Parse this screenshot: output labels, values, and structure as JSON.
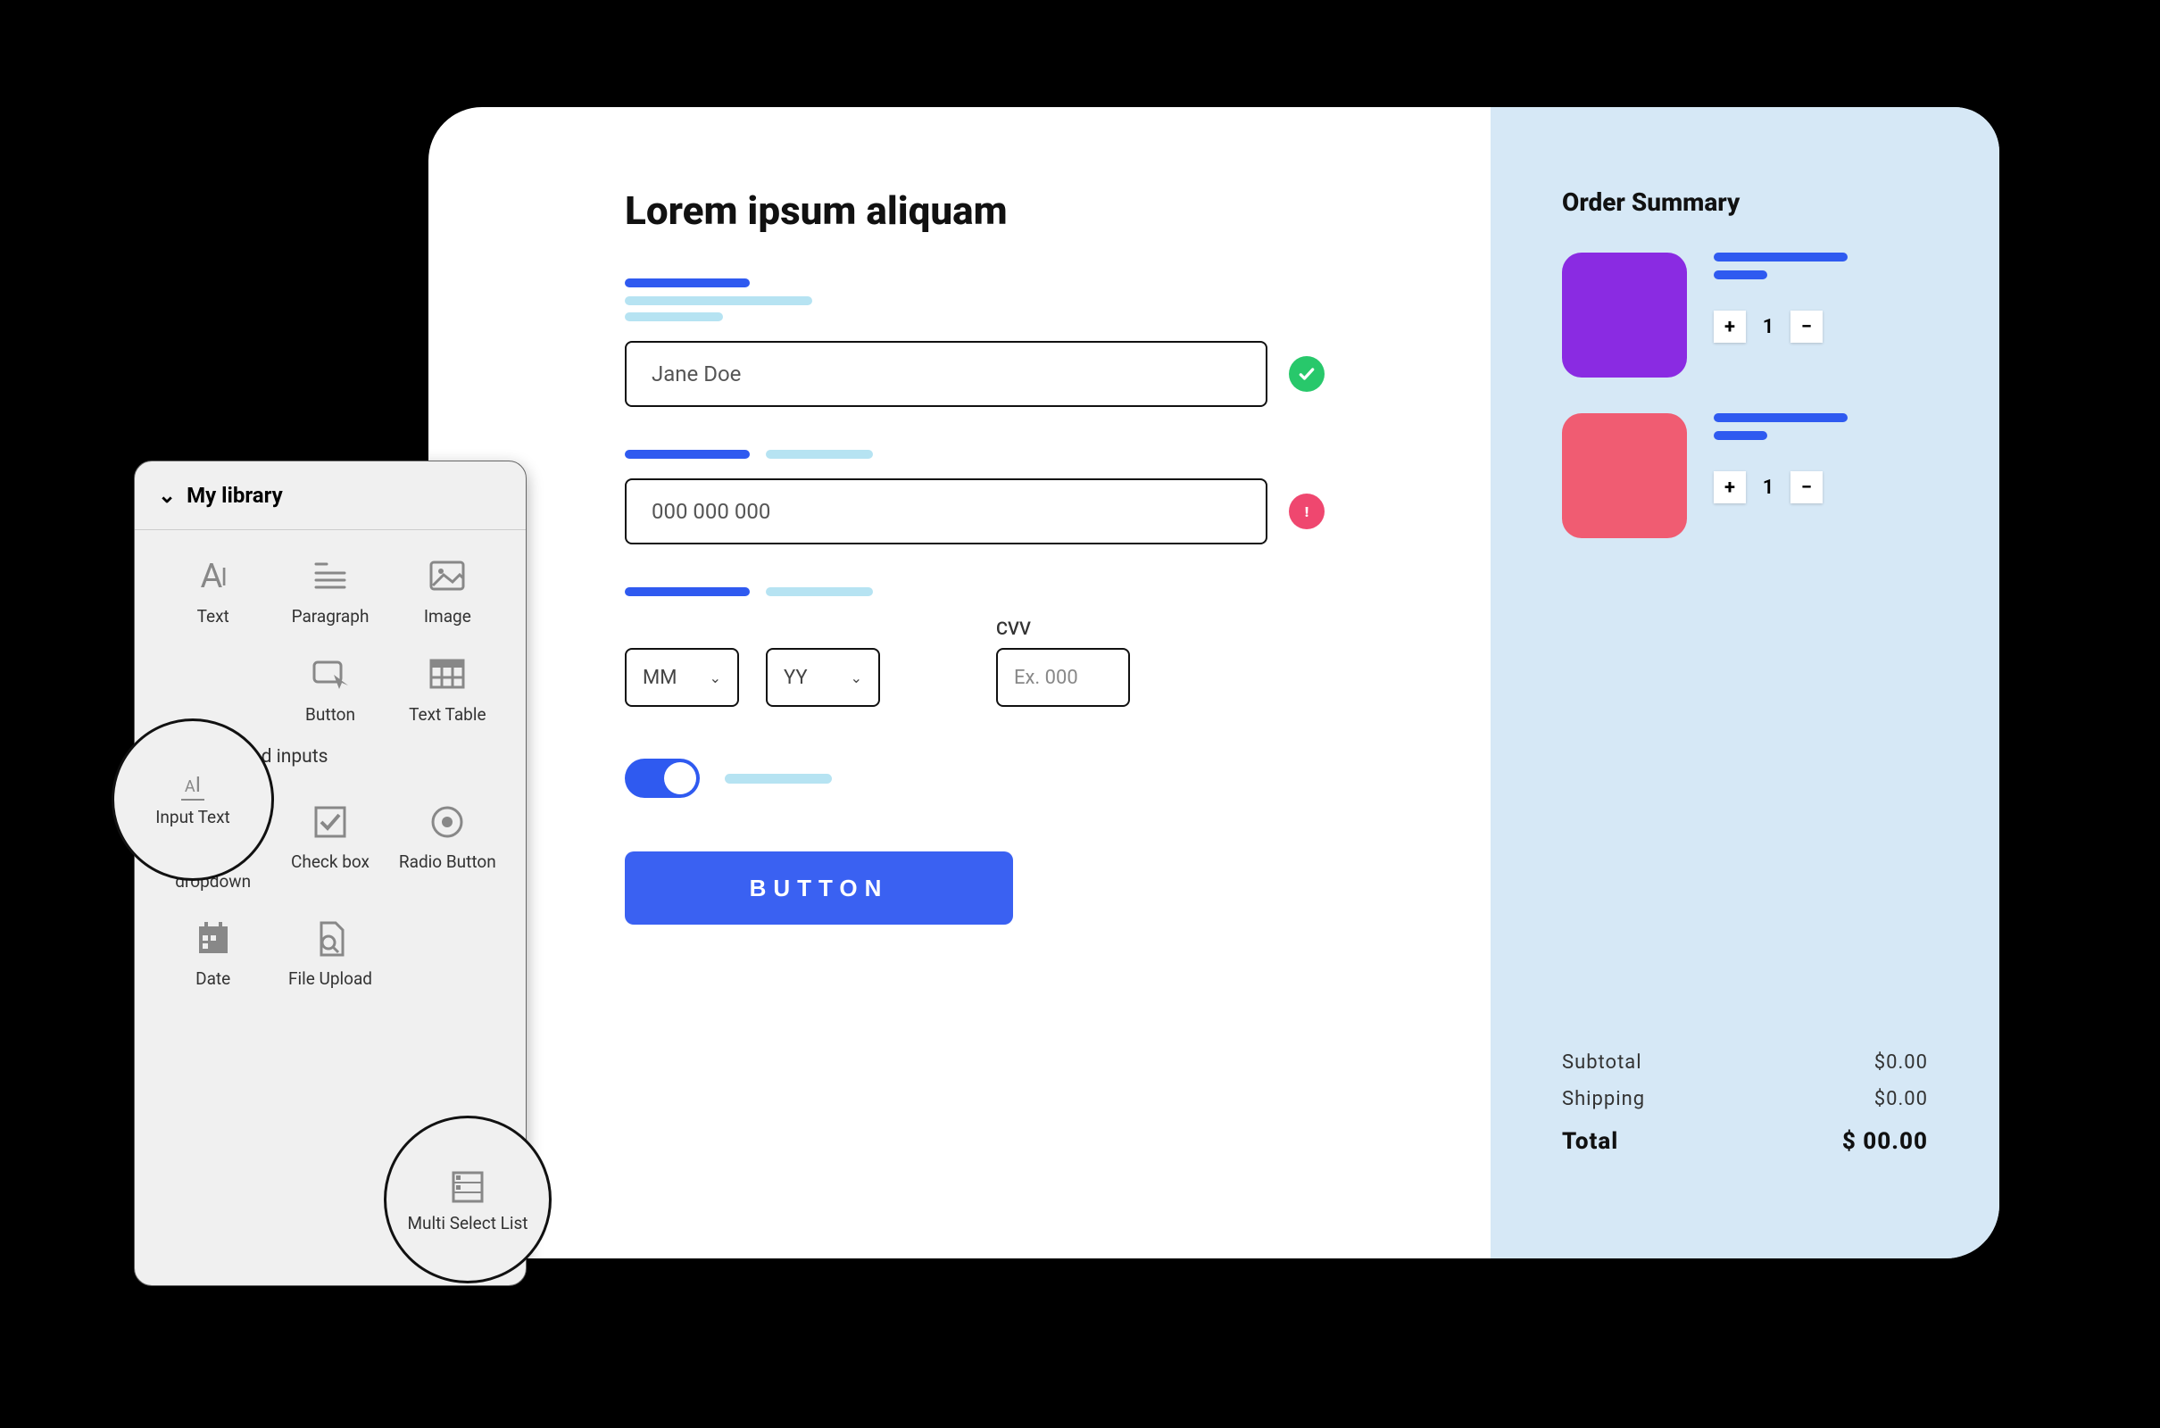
{
  "library": {
    "title": "My library",
    "items_row1": [
      "Text",
      "Paragraph",
      "Image"
    ],
    "items_row2": [
      "Input Text",
      "Button",
      "Text Table"
    ],
    "section2": "Forms and inputs",
    "items_row3": [
      "Native dropdown",
      "Check box",
      "Radio Button"
    ],
    "items_row4": [
      "Date",
      "File Upload",
      "Multi Select List"
    ],
    "highlight1": "Input Text",
    "highlight2": "Multi Select List"
  },
  "form": {
    "title": "Lorem ipsum aliquam",
    "name_value": "Jane Doe",
    "phone_value": "000 000 000",
    "mm": "MM",
    "yy": "YY",
    "cvv_label": "CVV",
    "cvv_placeholder": "Ex. 000",
    "button_label": "BUTTON"
  },
  "summary": {
    "title": "Order Summary",
    "item1_qty": "1",
    "item2_qty": "1",
    "subtotal_label": "Subtotal",
    "subtotal_value": "$0.00",
    "shipping_label": "Shipping",
    "shipping_value": "$0.00",
    "total_label": "Total",
    "total_value": "$ 00.00"
  }
}
